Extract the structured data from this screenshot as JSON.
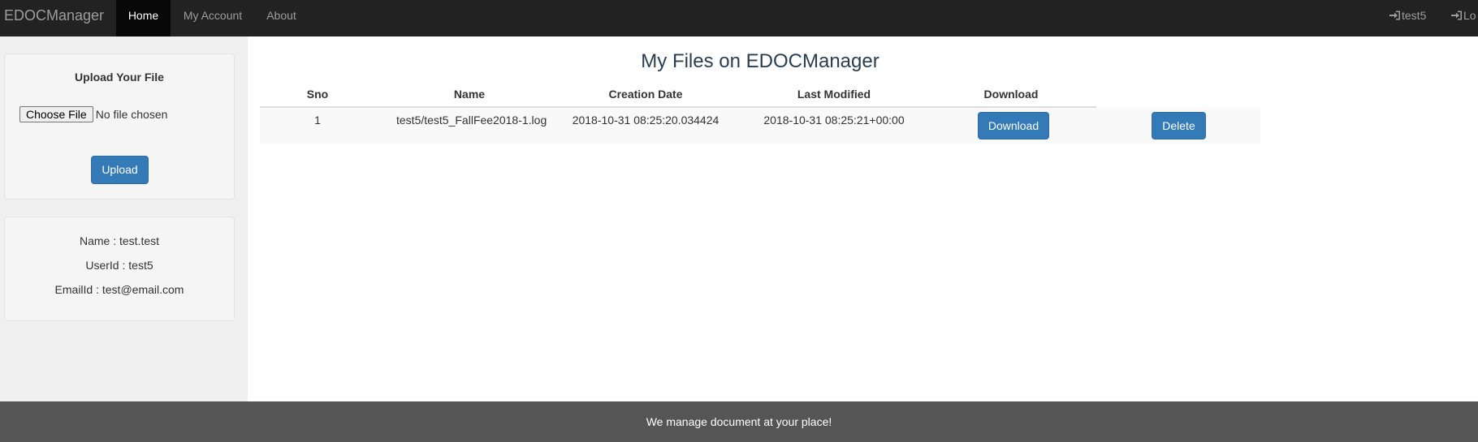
{
  "navbar": {
    "brand": "EDOCManager",
    "items": [
      {
        "label": "Home",
        "active": true
      },
      {
        "label": "My Account",
        "active": false
      },
      {
        "label": "About",
        "active": false
      }
    ],
    "user_label": "test5",
    "logout_label": "Lo"
  },
  "upload": {
    "title": "Upload Your File",
    "choose_label": "Choose File",
    "no_file_label": "No file chosen",
    "button_label": "Upload"
  },
  "profile": {
    "name": "Name : test.test",
    "userid": "UserId : test5",
    "email": "EmailId : test@email.com"
  },
  "main": {
    "title": "My Files on EDOCManager",
    "columns": [
      "Sno",
      "Name",
      "Creation Date",
      "Last Modified",
      "Download"
    ],
    "rows": [
      {
        "sno": "1",
        "name": "test5/test5_FallFee2018-1.log",
        "created": "2018-10-31 08:25:20.034424",
        "modified": "2018-10-31 08:25:21+00:00",
        "download_label": "Download",
        "delete_label": "Delete"
      }
    ]
  },
  "footer": {
    "text": "We manage document at your place!"
  },
  "colors": {
    "navbar_bg": "#222222",
    "primary": "#337ab7",
    "footer_bg": "#555555"
  }
}
